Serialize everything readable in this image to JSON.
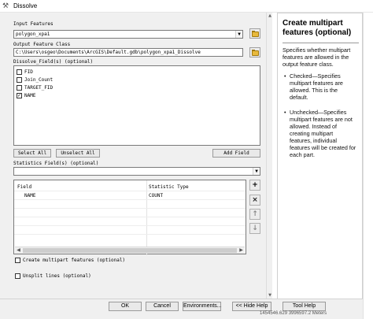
{
  "window": {
    "title": "Dissolve",
    "app_icon": "hammer-icon"
  },
  "input_features": {
    "label": "Input Features",
    "value": "polygon_xpa1",
    "icon": "folder-icon"
  },
  "output_feature_class": {
    "label": "Output Feature Class",
    "value": "C:\\Users\\osgeo\\Documents\\ArcGIS\\Default.gdb\\polygon_xpa1_Dissolve",
    "icon": "folder-icon"
  },
  "dissolve_fields": {
    "label": "Dissolve_Field(s) (optional)",
    "items": [
      {
        "name": "FID",
        "checked": false
      },
      {
        "name": "Join_Count",
        "checked": false
      },
      {
        "name": "TARGET_FID",
        "checked": false
      },
      {
        "name": "NAME",
        "checked": true
      }
    ],
    "select_all_label": "Select All",
    "unselect_all_label": "Unselect All",
    "add_field_label": "Add Field"
  },
  "statistics_fields": {
    "label": "Statistics Field(s) (optional)",
    "columns": [
      "Field",
      "Statistic Type"
    ],
    "rows": [
      {
        "field": "NAME",
        "statistic": "COUNT"
      }
    ]
  },
  "side_buttons": {
    "add": "+",
    "remove": "×",
    "up": "↑",
    "down": "↓"
  },
  "options": {
    "multipart_label": "Create multipart features (optional)",
    "multipart_checked": false,
    "unsplit_label": "Unsplit lines (optional)",
    "unsplit_checked": false
  },
  "help": {
    "title": "Create multipart features (optional)",
    "intro": "Specifies whether multipart features are allowed in the output feature class.",
    "bullets": [
      "Checked—Specifies multipart features are allowed. This is the default.",
      "Unchecked—Specifies multipart features are not allowed. Instead of creating multipart features, individual features will be created for each part."
    ]
  },
  "footer": {
    "ok": "OK",
    "cancel": "Cancel",
    "environments": "Environments...",
    "hide_help": "<< Hide Help",
    "tool_help": "Tool Help"
  },
  "status_coords": "1454546.629  3996597.2 Meters"
}
